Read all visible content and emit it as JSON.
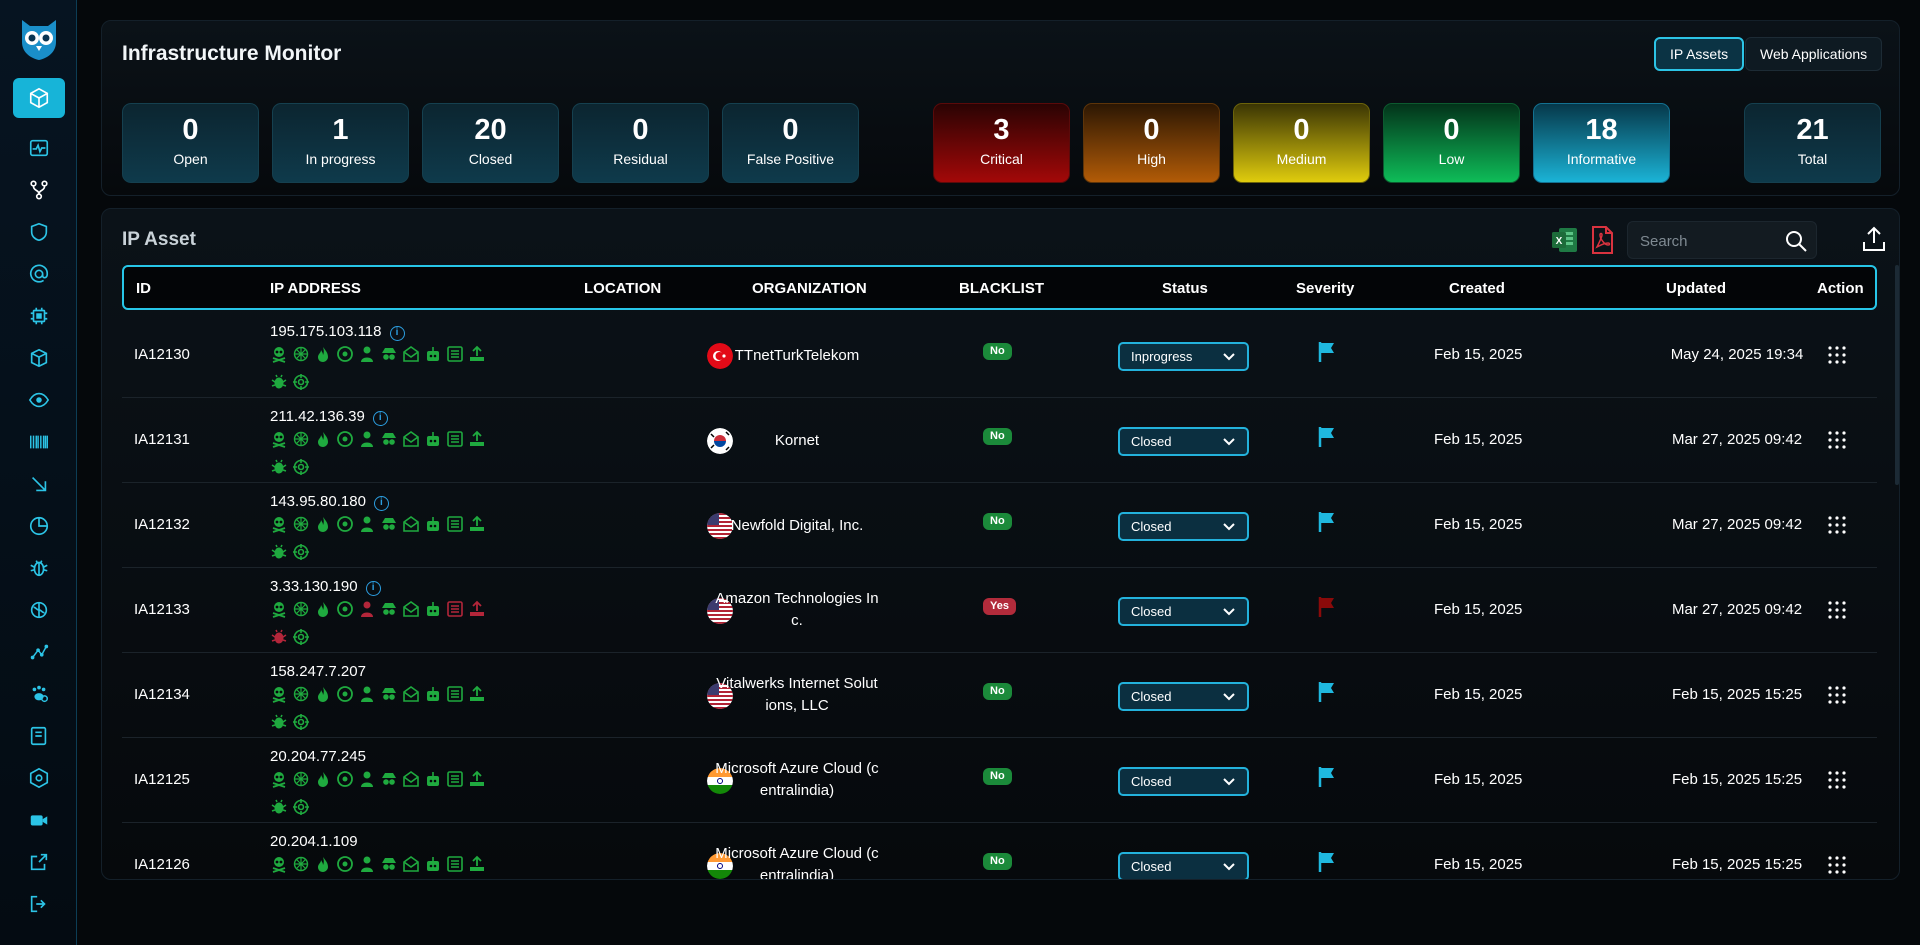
{
  "header": {
    "title": "Infrastructure Monitor",
    "tabs": [
      {
        "label": "IP Assets",
        "active": true
      },
      {
        "label": "Web Applications",
        "active": false
      }
    ]
  },
  "status_stats": [
    {
      "value": "0",
      "label": "Open"
    },
    {
      "value": "1",
      "label": "In progress"
    },
    {
      "value": "20",
      "label": "Closed"
    },
    {
      "value": "0",
      "label": "Residual"
    },
    {
      "value": "0",
      "label": "False Positive"
    }
  ],
  "severity_stats": [
    {
      "value": "3",
      "label": "Critical"
    },
    {
      "value": "0",
      "label": "High"
    },
    {
      "value": "0",
      "label": "Medium"
    },
    {
      "value": "0",
      "label": "Low"
    },
    {
      "value": "18",
      "label": "Informative"
    }
  ],
  "total_stat": {
    "value": "21",
    "label": "Total"
  },
  "table": {
    "title": "IP Asset",
    "search_placeholder": "Search",
    "columns": {
      "id": "ID",
      "ip": "IP ADDRESS",
      "location": "LOCATION",
      "organization": "ORGANIZATION",
      "blacklist": "BLACKLIST",
      "status": "Status",
      "severity": "Severity",
      "created": "Created",
      "updated": "Updated",
      "action": "Action"
    },
    "rows": [
      {
        "id": "IA12130",
        "ip": "195.175.103.118",
        "info": true,
        "country": "TR",
        "org": [
          "TTnetTurkTelekom"
        ],
        "blacklist": "No",
        "status": "Inprogress",
        "severity": "informative",
        "created": "Feb 15, 2025",
        "updated": "May 24, 2025 19:34"
      },
      {
        "id": "IA12131",
        "ip": "211.42.136.39",
        "info": true,
        "country": "KR",
        "org": [
          "Kornet"
        ],
        "blacklist": "No",
        "status": "Closed",
        "severity": "informative",
        "created": "Feb 15, 2025",
        "updated": "Mar 27, 2025 09:42"
      },
      {
        "id": "IA12132",
        "ip": "143.95.80.180",
        "info": true,
        "country": "US",
        "org": [
          "Newfold Digital, Inc."
        ],
        "blacklist": "No",
        "status": "Closed",
        "severity": "informative",
        "created": "Feb 15, 2025",
        "updated": "Mar 27, 2025 09:42"
      },
      {
        "id": "IA12133",
        "ip": "3.33.130.190",
        "info": true,
        "country": "US",
        "org": [
          "Amazon Technologies In",
          "c."
        ],
        "blacklist": "Yes",
        "status": "Closed",
        "severity": "critical",
        "created": "Feb 15, 2025",
        "updated": "Mar 27, 2025 09:42"
      },
      {
        "id": "IA12134",
        "ip": "158.247.7.207",
        "info": false,
        "country": "US",
        "org": [
          "Vitalwerks Internet Solut",
          "ions, LLC"
        ],
        "blacklist": "No",
        "status": "Closed",
        "severity": "informative",
        "created": "Feb 15, 2025",
        "updated": "Feb 15, 2025 15:25"
      },
      {
        "id": "IA12125",
        "ip": "20.204.77.245",
        "info": false,
        "country": "IN",
        "org": [
          "Microsoft Azure Cloud (c",
          "entralindia)"
        ],
        "blacklist": "No",
        "status": "Closed",
        "severity": "informative",
        "created": "Feb 15, 2025",
        "updated": "Feb 15, 2025 15:25"
      },
      {
        "id": "IA12126",
        "ip": "20.204.1.109",
        "info": false,
        "country": "IN",
        "org": [
          "Microsoft Azure Cloud (c",
          "entralindia)"
        ],
        "blacklist": "No",
        "status": "Closed",
        "severity": "informative",
        "created": "Feb 15, 2025",
        "updated": "Feb 15, 2025 15:25"
      }
    ]
  },
  "colors": {
    "accent": "#27c6e8",
    "check_green": "#1faa3f",
    "check_red": "#b3263a",
    "flag_info": "#1fb8df",
    "flag_critical": "#8a0a0a"
  },
  "sidebar_icons": [
    "cube-icon",
    "activity-icon",
    "git-branch-icon",
    "shield-icon",
    "at-sign-icon",
    "chip-icon",
    "package-icon",
    "eye-icon",
    "barcode-icon",
    "arrow-down-right-icon",
    "pie-chart-icon",
    "bug-icon",
    "brain-icon",
    "graph-icon",
    "paw-icon",
    "book-icon",
    "settings-hex-icon",
    "video-icon",
    "external-link-icon",
    "logout-icon"
  ]
}
